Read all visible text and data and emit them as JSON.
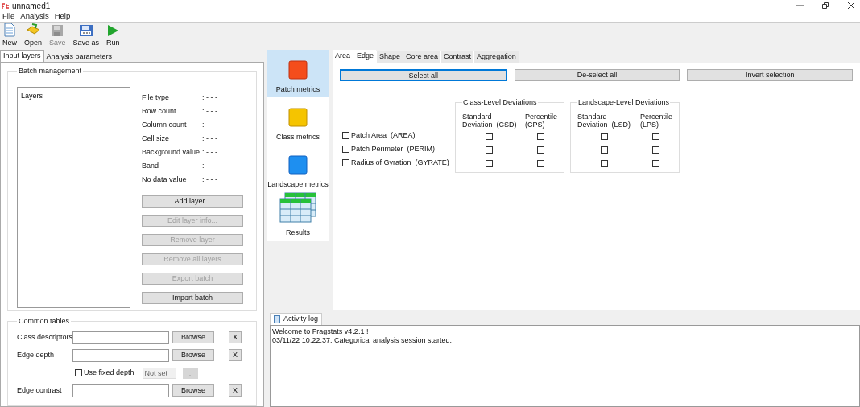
{
  "window": {
    "title": "unnamed1"
  },
  "menu": [
    "File",
    "Analysis",
    "Help"
  ],
  "toolbar": [
    {
      "label": "New",
      "kind": "new",
      "disabled": false
    },
    {
      "label": "Open",
      "kind": "open",
      "disabled": false
    },
    {
      "label": "Save",
      "kind": "save",
      "disabled": true
    },
    {
      "label": "Save as",
      "kind": "saveas",
      "disabled": false
    },
    {
      "label": "Run",
      "kind": "run",
      "disabled": false
    }
  ],
  "left_tabs": [
    {
      "label": "Input layers",
      "selected": true
    },
    {
      "label": "Analysis parameters",
      "selected": false
    }
  ],
  "batch_management": {
    "title": "Batch management",
    "list_header": "Layers",
    "info": [
      {
        "label": "File type",
        "value": ": - - -"
      },
      {
        "label": "Row count",
        "value": ": - - -"
      },
      {
        "label": "Column count",
        "value": ": - - -"
      },
      {
        "label": "Cell size",
        "value": ": - - -"
      },
      {
        "label": "Background value",
        "value": ": - - -"
      },
      {
        "label": "Band",
        "value": ": - - -"
      },
      {
        "label": "No data value",
        "value": ": - - -"
      }
    ],
    "buttons": [
      {
        "label": "Add layer...",
        "disabled": false
      },
      {
        "label": "Edit layer info...",
        "disabled": true
      },
      {
        "label": "Remove layer",
        "disabled": true
      },
      {
        "label": "Remove all layers",
        "disabled": true
      },
      {
        "label": "Export batch",
        "disabled": true
      },
      {
        "label": "Import batch",
        "disabled": false
      }
    ]
  },
  "common_tables": {
    "title": "Common tables",
    "rows": [
      {
        "kind": "table",
        "label": "Class descriptors",
        "browse": "Browse",
        "clear": "X"
      },
      {
        "kind": "table",
        "label": "Edge depth",
        "browse": "Browse",
        "clear": "X"
      },
      {
        "kind": "fixed",
        "label": "Use fixed depth",
        "checked": false,
        "value": "Not set",
        "button": "..."
      },
      {
        "kind": "table",
        "label": "Edge contrast",
        "browse": "Browse",
        "clear": "X"
      }
    ]
  },
  "metric_levels": [
    {
      "label": "Patch metrics",
      "kind": "patch",
      "selected": true
    },
    {
      "label": "Class metrics",
      "kind": "class",
      "selected": false
    },
    {
      "label": "Landscape metrics",
      "kind": "landscape",
      "selected": false
    },
    {
      "label": "Results",
      "kind": "results",
      "selected": false
    }
  ],
  "metric_tabs": [
    {
      "label": "Area - Edge",
      "selected": true
    },
    {
      "label": "Shape",
      "selected": false
    },
    {
      "label": "Core area",
      "selected": false
    },
    {
      "label": "Contrast",
      "selected": false
    },
    {
      "label": "Aggregation",
      "selected": false
    }
  ],
  "selection_buttons": [
    {
      "label": "Select all",
      "focused": true
    },
    {
      "label": "De-select all",
      "focused": false
    },
    {
      "label": "Invert selection",
      "focused": false
    }
  ],
  "deviation_groups": [
    {
      "title": "Class-Level Deviations",
      "columns": [
        "Standard\nDeviation  (CSD)",
        "Percentile\n(CPS)"
      ]
    },
    {
      "title": "Landscape-Level Deviations",
      "columns": [
        "Standard\nDeviation  (LSD)",
        "Percentile\n(LPS)"
      ]
    }
  ],
  "metrics": [
    {
      "label": "Patch Area  (AREA)",
      "checked": false,
      "deviations": [
        false,
        false,
        false,
        false
      ]
    },
    {
      "label": "Patch Perimeter  (PERIM)",
      "checked": false,
      "deviations": [
        false,
        false,
        false,
        false
      ]
    },
    {
      "label": "Radius of Gyration  (GYRATE)",
      "checked": false,
      "deviations": [
        false,
        false,
        false,
        false
      ]
    }
  ],
  "activity_log": {
    "tab": "Activity log",
    "lines": [
      "Welcome to Fragstats v4.2.1 !",
      "03/11/22 10:22:37: Categorical analysis session started."
    ]
  }
}
